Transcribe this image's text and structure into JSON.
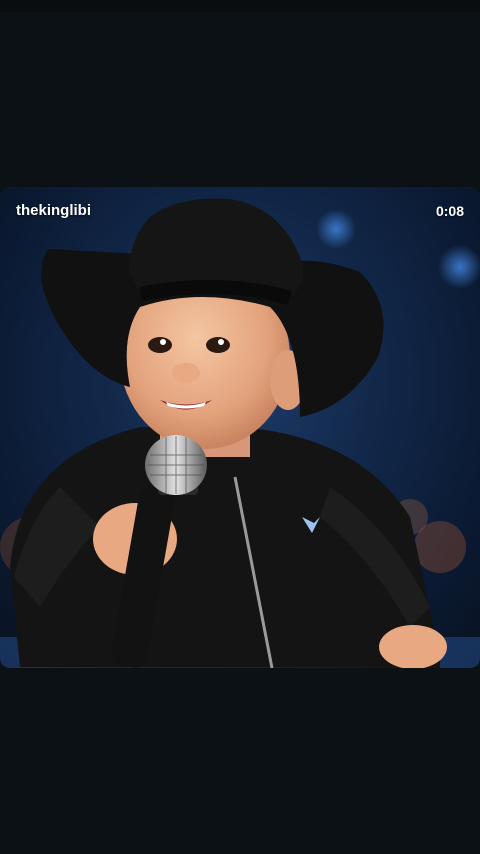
{
  "overlay": {
    "username": "thekinglibi",
    "timestamp": "0:08"
  },
  "colors": {
    "background": "#0c1116",
    "stage_blue": "#1d3b6a",
    "overlay_text": "#ffffff"
  },
  "media": {
    "subject": "baby-in-cowboy-hat-with-microphone-image"
  }
}
